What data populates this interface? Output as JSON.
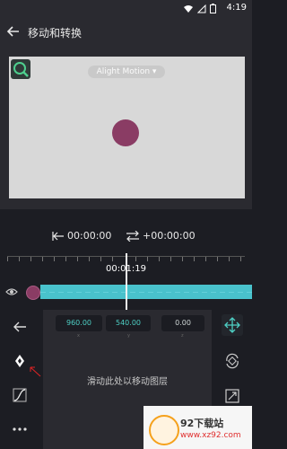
{
  "status_bar": {
    "time": "4:19"
  },
  "app_bar": {
    "title": "移动和转换"
  },
  "preview": {
    "watermark": "Alight Motion ▾"
  },
  "time_controls": {
    "start_time": "00:00:00",
    "offset_time": "+00:00:00"
  },
  "timeline": {
    "playhead_time": "00:01:19"
  },
  "properties": {
    "x_value": "960.00",
    "y_value": "540.00",
    "z_value": "0.00",
    "x_label": "x",
    "y_label": "y",
    "z_label": "z",
    "drag_hint": "滑动此处以移动图层"
  },
  "ad": {
    "brand": "92下载站",
    "url": "www.xz92.com"
  },
  "colors": {
    "accent": "#49c2cc",
    "object": "#8a3c64",
    "value_text": "#4ecfc4"
  }
}
